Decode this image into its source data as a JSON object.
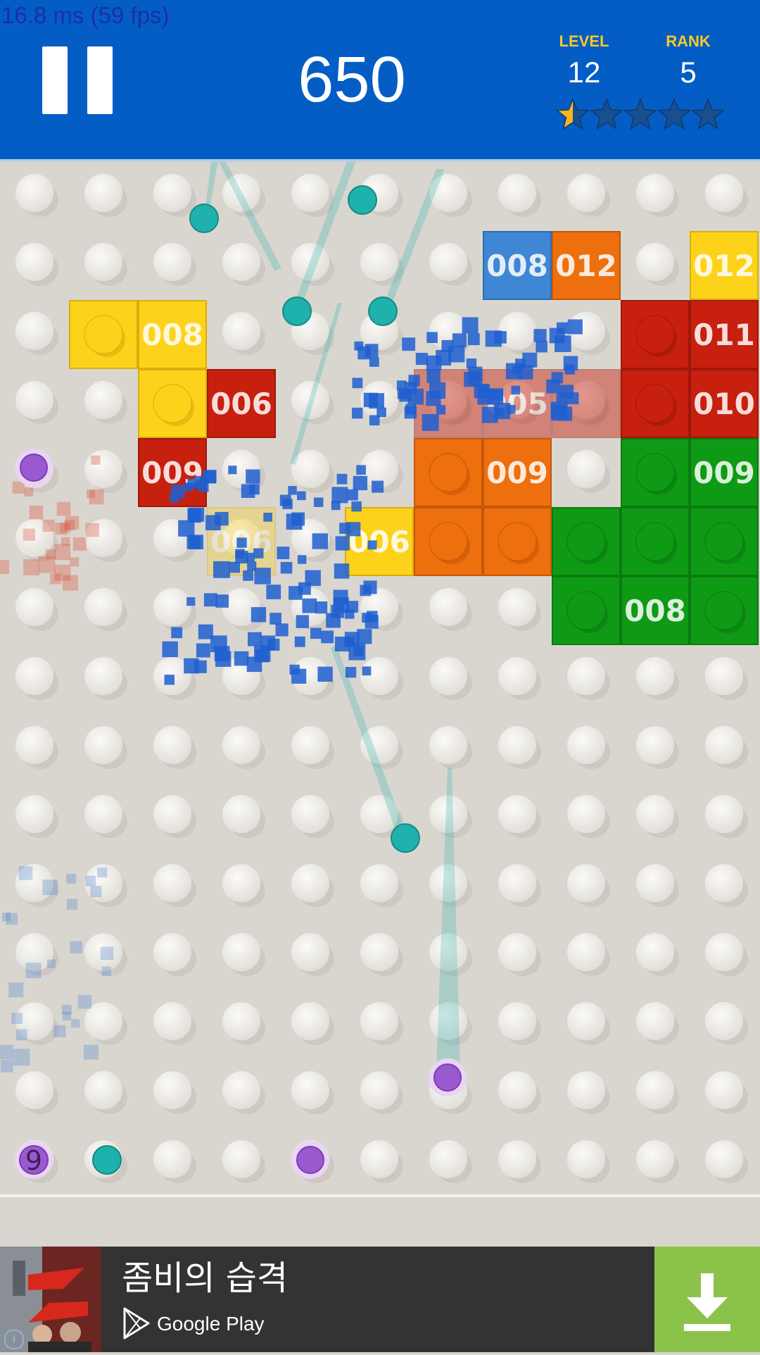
{
  "debug": {
    "frame_time": "16.8 ms (59 fps)"
  },
  "header": {
    "score": "650",
    "level_label": "LEVEL",
    "level_value": "12",
    "rank_label": "RANK",
    "rank_value": "5",
    "stars_total": 5,
    "stars_filled_fraction": 0.1,
    "pause_icon": "pause-icon"
  },
  "colors": {
    "header_bg": "#045dc4",
    "board_bg": "#d9d6d0",
    "stud": "#ece9e4",
    "blue": "#3f86d4",
    "orange": "#ee6f0d",
    "yellow": "#fdd21b",
    "red": "#c8200e",
    "green": "#0f9a16",
    "ball": "#1fb1ab",
    "powerup": "#9b59d0",
    "star_filled": "#f9b51c",
    "star_empty": "#1a4f8f"
  },
  "board": {
    "columns": 11,
    "rows": 15,
    "blocks": [
      {
        "row": 1,
        "col": 7,
        "color": "blue",
        "label": "008"
      },
      {
        "row": 1,
        "col": 8,
        "color": "orange",
        "label": "012"
      },
      {
        "row": 1,
        "col": 10,
        "color": "yellow",
        "label": "012"
      },
      {
        "row": 2,
        "col": 1,
        "color": "yellow",
        "label": ""
      },
      {
        "row": 2,
        "col": 2,
        "color": "yellow",
        "label": "008"
      },
      {
        "row": 2,
        "col": 9,
        "color": "red",
        "label": ""
      },
      {
        "row": 2,
        "col": 10,
        "color": "red",
        "label": "011"
      },
      {
        "row": 3,
        "col": 2,
        "color": "yellow",
        "label": ""
      },
      {
        "row": 3,
        "col": 3,
        "color": "red",
        "label": "006"
      },
      {
        "row": 3,
        "col": 6,
        "color": "red",
        "label": "",
        "faded": true
      },
      {
        "row": 3,
        "col": 7,
        "color": "red",
        "label": "005",
        "faded": true
      },
      {
        "row": 3,
        "col": 8,
        "color": "red",
        "label": "",
        "faded": true
      },
      {
        "row": 3,
        "col": 9,
        "color": "red",
        "label": ""
      },
      {
        "row": 3,
        "col": 10,
        "color": "red",
        "label": "010"
      },
      {
        "row": 4,
        "col": 2,
        "color": "red",
        "label": "009"
      },
      {
        "row": 4,
        "col": 6,
        "color": "orange",
        "label": ""
      },
      {
        "row": 4,
        "col": 7,
        "color": "orange",
        "label": "009"
      },
      {
        "row": 4,
        "col": 9,
        "color": "green",
        "label": ""
      },
      {
        "row": 4,
        "col": 10,
        "color": "green",
        "label": "009"
      },
      {
        "row": 5,
        "col": 3,
        "color": "yellow",
        "label": "006",
        "faded": true
      },
      {
        "row": 5,
        "col": 5,
        "color": "yellow",
        "label": "006"
      },
      {
        "row": 5,
        "col": 6,
        "color": "orange",
        "label": ""
      },
      {
        "row": 5,
        "col": 7,
        "color": "orange",
        "label": ""
      },
      {
        "row": 5,
        "col": 8,
        "color": "green",
        "label": ""
      },
      {
        "row": 5,
        "col": 9,
        "color": "green",
        "label": ""
      },
      {
        "row": 5,
        "col": 10,
        "color": "green",
        "label": ""
      },
      {
        "row": 6,
        "col": 8,
        "color": "green",
        "label": ""
      },
      {
        "row": 6,
        "col": 9,
        "color": "green",
        "label": "008"
      },
      {
        "row": 6,
        "col": 10,
        "color": "green",
        "label": ""
      }
    ],
    "balls_in_flight": 6,
    "launcher": {
      "balls_remaining": "9"
    },
    "powerups": 3
  },
  "ad": {
    "title": "좀비의 습격",
    "store": "Google Play",
    "info_glyph": "i",
    "download_icon": "download-icon",
    "thumbnail": "zombie-game-thumbnail"
  }
}
